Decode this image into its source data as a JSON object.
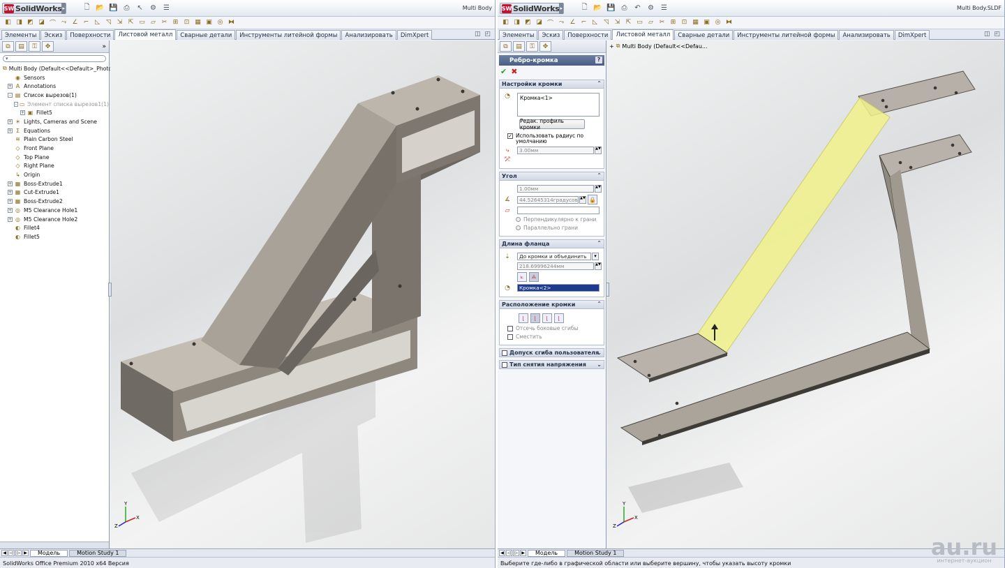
{
  "left": {
    "app_logo": "SolidWorks",
    "doc_title": "Multi Body",
    "tabs": [
      "Элементы",
      "Эскиз",
      "Поверхности",
      "Листовой металл",
      "Сварные детали",
      "Инструменты литейной формы",
      "Анализировать",
      "DimXpert"
    ],
    "active_tab": "Листовой металл",
    "tree": [
      {
        "label": "Multi Body  (Default<<Default>_PhotoW",
        "level": 0,
        "exp": "",
        "icon": "part-icon"
      },
      {
        "label": "Sensors",
        "level": 1,
        "exp": "",
        "icon": "sensor-icon"
      },
      {
        "label": "Annotations",
        "level": 1,
        "exp": "+",
        "icon": "annotation-icon"
      },
      {
        "label": "Список вырезов(1)",
        "level": 1,
        "exp": "-",
        "icon": "cutlist-icon"
      },
      {
        "label": "Элемент списка вырезов1(1)",
        "level": 2,
        "exp": "-",
        "icon": "folder-icon",
        "grey": true
      },
      {
        "label": "Fillet5",
        "level": 3,
        "exp": "+",
        "icon": "body-icon"
      },
      {
        "label": "Lights, Cameras and Scene",
        "level": 1,
        "exp": "+",
        "icon": "lights-icon"
      },
      {
        "label": "Equations",
        "level": 1,
        "exp": "+",
        "icon": "equations-icon"
      },
      {
        "label": "Plain Carbon Steel",
        "level": 1,
        "exp": "",
        "icon": "material-icon"
      },
      {
        "label": "Front Plane",
        "level": 1,
        "exp": "",
        "icon": "plane-icon"
      },
      {
        "label": "Top Plane",
        "level": 1,
        "exp": "",
        "icon": "plane-icon"
      },
      {
        "label": "Right Plane",
        "level": 1,
        "exp": "",
        "icon": "plane-icon"
      },
      {
        "label": "Origin",
        "level": 1,
        "exp": "",
        "icon": "origin-icon"
      },
      {
        "label": "Boss-Extrude1",
        "level": 1,
        "exp": "+",
        "icon": "feature-icon"
      },
      {
        "label": "Cut-Extrude1",
        "level": 1,
        "exp": "+",
        "icon": "feature-icon"
      },
      {
        "label": "Boss-Extrude2",
        "level": 1,
        "exp": "+",
        "icon": "feature-icon"
      },
      {
        "label": "M5 Clearance Hole1",
        "level": 1,
        "exp": "+",
        "icon": "hole-icon"
      },
      {
        "label": "M5 Clearance Hole2",
        "level": 1,
        "exp": "+",
        "icon": "hole-icon"
      },
      {
        "label": "Fillet4",
        "level": 1,
        "exp": "",
        "icon": "fillet-icon"
      },
      {
        "label": "Fillet5",
        "level": 1,
        "exp": "",
        "icon": "fillet-icon"
      }
    ],
    "bottom_tabs": [
      "Модель",
      "Motion Study 1"
    ],
    "status": "SolidWorks Office Premium 2010 x64 Версия"
  },
  "right": {
    "app_logo": "SolidWorks",
    "doc_title": "Multi Body.SLDF",
    "tabs": [
      "Элементы",
      "Эскиз",
      "Поверхности",
      "Листовой металл",
      "Сварные детали",
      "Инструменты литейной формы",
      "Анализировать",
      "DimXpert"
    ],
    "active_tab": "Листовой металл",
    "tree_root": "Multi Body  (Default<<Defau...",
    "pm": {
      "title": "Ребро-кромка",
      "help": "?",
      "sec1": {
        "title": "Настройки кромки",
        "edge_item": "Кромка<1>",
        "edit_btn": "Редак. профиль кромки",
        "use_default_radius": "Использовать радиус по умолчанию",
        "radius": "3.00мм"
      },
      "sec2": {
        "title": "Угол",
        "thickness": "1.00мм",
        "angle": "44.52645314градусов",
        "perp": "Перпендикулярно к грани",
        "parallel": "Параллельно грани"
      },
      "sec3": {
        "title": "Длина фланца",
        "mode": "До кромки и объединить",
        "length": "218.69996244мм",
        "edge2": "Кромка<2>"
      },
      "sec4": {
        "title": "Расположение кромки",
        "trim": "Отсечь боковые сгибы",
        "offset": "Сместить"
      },
      "sec5": "Допуск сгиба пользователя",
      "sec6": "Тип снятия напряжения"
    },
    "bottom_tabs": [
      "Модель",
      "Motion Study 1"
    ],
    "status": "Выберите где-либо в графической области или выберите вершину, чтобы указать высоту кромки"
  },
  "watermark": {
    "main": "au.ru",
    "sub": "интернет-аукцион"
  },
  "colors": {
    "accent": "#4a5d83",
    "highlight": "#f1f28a",
    "metal": "#8a847c"
  }
}
